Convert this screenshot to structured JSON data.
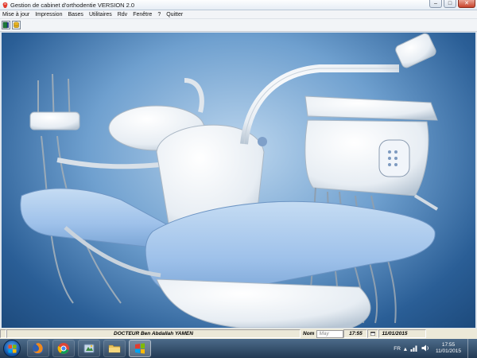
{
  "window": {
    "title": "Gestion de cabinet d'orthodentie   VERSION 2.0",
    "controls": {
      "minimize": "–",
      "maximize": "□",
      "close": "✕"
    }
  },
  "menu": [
    "Mise à jour",
    "Impression",
    "Bases",
    "Utilitaires",
    "Rdv",
    "Fenêtre",
    "?",
    "Quitter"
  ],
  "toolbar": {
    "icons": [
      "exit-door-icon",
      "database-icon"
    ]
  },
  "background": {
    "description_icon": "dental-chair-image"
  },
  "statusbar": {
    "doctor": "DOCTEUR Ben Abdallah YAMEN",
    "nom_label": "Nom",
    "nom_value": "May",
    "time": "17:55",
    "calendar_icon": "calendar-icon",
    "date": "11/01/2015"
  },
  "taskbar": {
    "apps": [
      "firefox-icon",
      "chrome-icon",
      "windows-explorer-icon",
      "folder-icon",
      "app-window-icon"
    ],
    "language": "FR",
    "clock_time": "17:55",
    "clock_date": "11/01/2015"
  },
  "colors": {
    "taskbar": "#233a54",
    "background_blue": "#6fa0cf",
    "chair_blue": "#9ec1ea"
  }
}
